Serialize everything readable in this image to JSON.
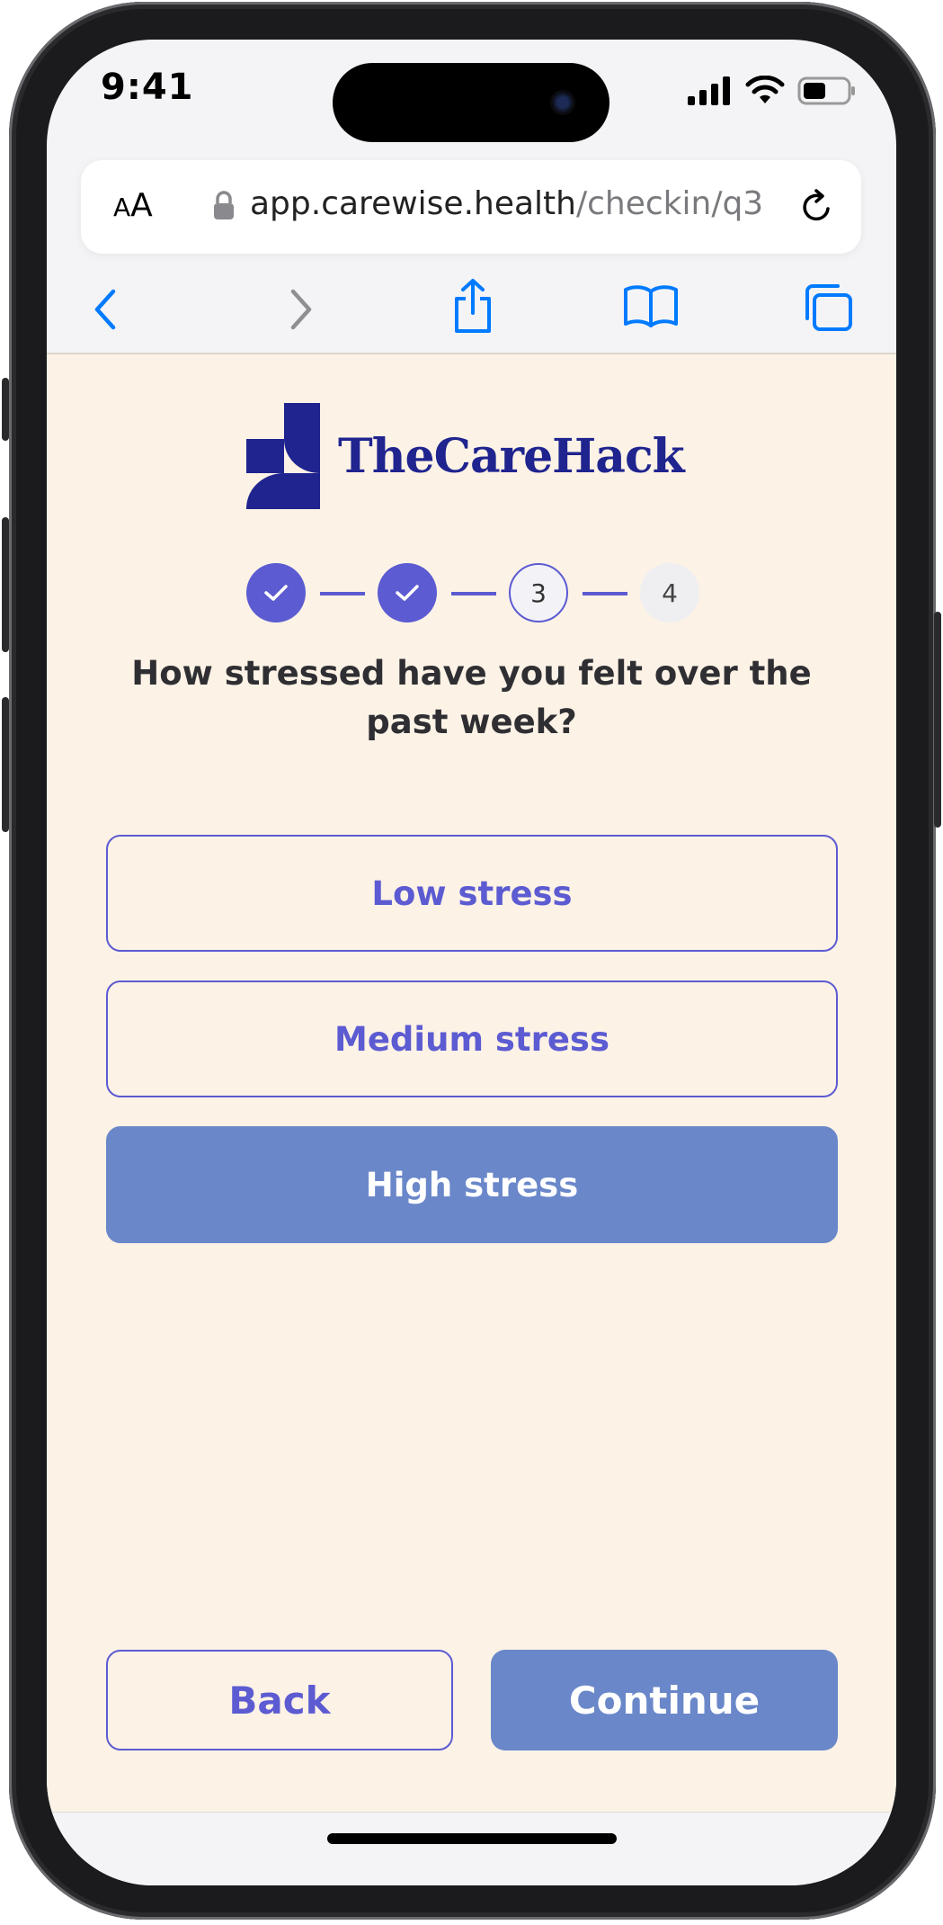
{
  "status_bar": {
    "time": "9:41"
  },
  "browser": {
    "text_size_label": "AA",
    "url_host": "app.carewise.health",
    "url_path": "/checkin/q3",
    "accent_color": "#007aff"
  },
  "brand": {
    "name": "TheCareHack",
    "color": "#1f248f"
  },
  "stepper": {
    "steps": [
      {
        "label": "",
        "state": "complete"
      },
      {
        "label": "",
        "state": "complete"
      },
      {
        "label": "3",
        "state": "current"
      },
      {
        "label": "4",
        "state": "upcoming"
      }
    ]
  },
  "question": {
    "text": "How stressed have you felt over the past week?"
  },
  "options": [
    {
      "label": "Low stress",
      "selected": false
    },
    {
      "label": "Medium stress",
      "selected": false
    },
    {
      "label": "High stress",
      "selected": true
    }
  ],
  "actions": {
    "back_label": "Back",
    "continue_label": "Continue"
  },
  "colors": {
    "primary": "#5c5bd2",
    "selected_fill": "#6a87c9",
    "page_background": "#fcf2e6"
  }
}
